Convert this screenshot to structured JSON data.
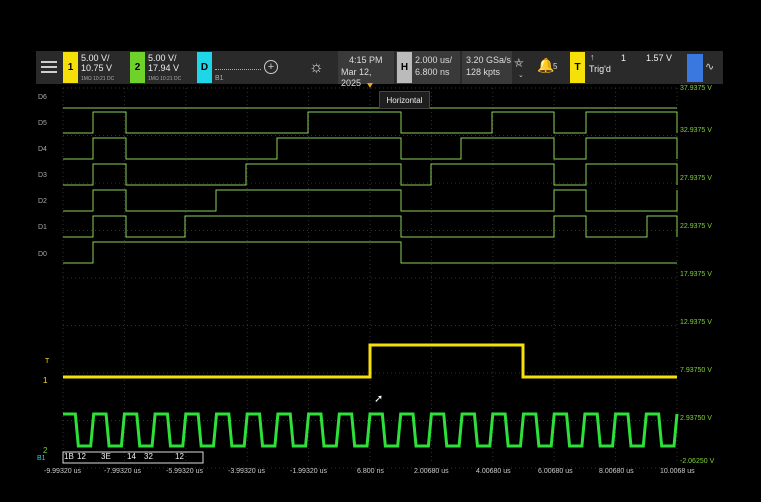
{
  "channel1": {
    "scale": "5.00 V/",
    "offset": "10.75 V",
    "info": "1MΩ  10:21  DC",
    "badge": "1",
    "color": "#f5e00a"
  },
  "channel2": {
    "scale": "5.00 V/",
    "offset": "17.94 V",
    "info": "1MΩ  10:21  DC",
    "badge": "2",
    "color": "#6fd22a"
  },
  "digital": {
    "badge": "D",
    "sub": "B1",
    "color": "#1fd6e8"
  },
  "datetime": {
    "time": "4:15 PM",
    "date": "Mar 12, 2025"
  },
  "horizontal": {
    "badge": "H",
    "scale": "2.000 us/",
    "delay": "6.800 ns"
  },
  "acquisition": {
    "rate": "3.20 GSa/s",
    "points": "128 kpts"
  },
  "alerts": {
    "count": "5"
  },
  "trigger": {
    "badge": "T",
    "source": "1",
    "level": "1.57 V",
    "status": "Trig'd"
  },
  "tooltip": "Horizontal",
  "digital_labels": [
    "D6",
    "D5",
    "D4",
    "D3",
    "D2",
    "D1",
    "D0"
  ],
  "y_labels": [
    "37.9375 V",
    "32.9375 V",
    "27.9375 V",
    "22.9375 V",
    "17.9375 V",
    "12.9375 V",
    "7.93750 V",
    "2.93750 V",
    "-2.06250 V"
  ],
  "x_labels": [
    "-9.99320 us",
    "-7.99320 us",
    "-5.99320 us",
    "-3.99320 us",
    "-1.99320 us",
    "6.800 ns",
    "2.00680 us",
    "4.00680 us",
    "6.00680 us",
    "8.00680 us",
    "10.0068 us"
  ],
  "markers": {
    "trigger": "T",
    "ch1": "1",
    "ch2": "2",
    "bus": "B1"
  },
  "bus_values": [
    "1B",
    "12",
    "3E",
    "14",
    "32",
    "12"
  ]
}
